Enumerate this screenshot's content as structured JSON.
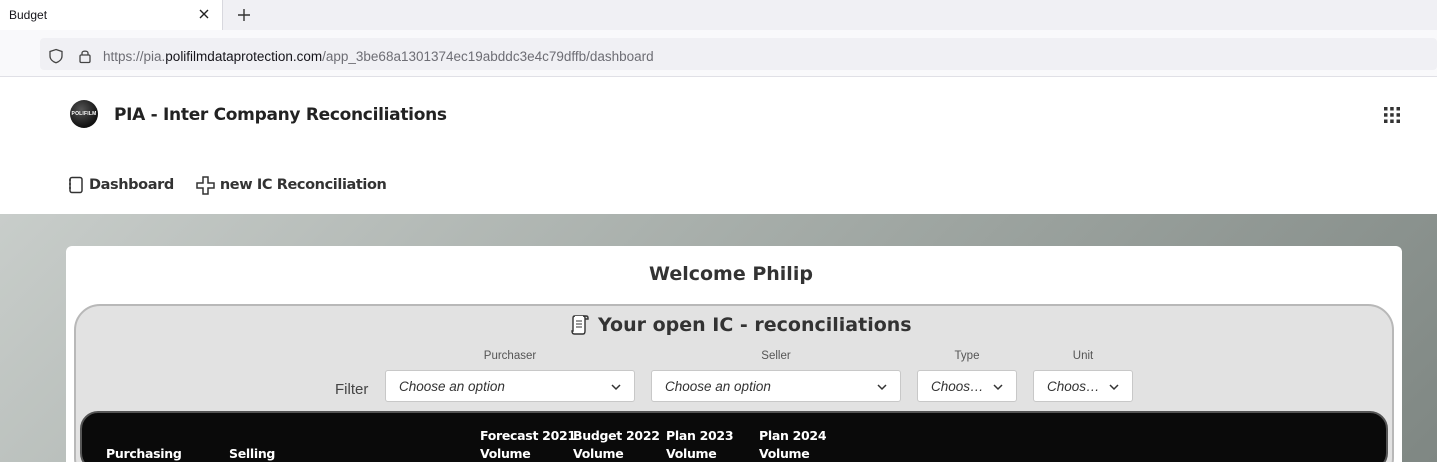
{
  "browser": {
    "tab_title": "Budget",
    "url_prefix": "https://pia.",
    "url_domain": "polifilmdataprotection.com",
    "url_path": "/app_3be68a1301374ec19abddc3e4c79dffb/dashboard"
  },
  "app": {
    "logo_text": "POLIFILM",
    "title": "PIA - Inter Company Reconciliations",
    "nav": [
      {
        "label": "Dashboard",
        "icon": "notebook-icon"
      },
      {
        "label": "new IC Reconciliation",
        "icon": "plus-icon"
      }
    ]
  },
  "main": {
    "welcome": "Welcome Philip",
    "panel_title": "Your open IC - reconciliations",
    "filter_label": "Filter",
    "filters": [
      {
        "label": "Purchaser",
        "value": "Choose an option"
      },
      {
        "label": "Seller",
        "value": "Choose an option"
      },
      {
        "label": "Type",
        "value": "Choos…"
      },
      {
        "label": "Unit",
        "value": "Choos…"
      }
    ],
    "table_headers": [
      {
        "line1": "",
        "line2": "Purchasing"
      },
      {
        "line1": "",
        "line2": "Selling"
      },
      {
        "line1": "Forecast 2021",
        "line2": "Volume"
      },
      {
        "line1": "Budget 2022",
        "line2": "Volume"
      },
      {
        "line1": "Plan 2023",
        "line2": "Volume"
      },
      {
        "line1": "Plan 2024",
        "line2": "Volume"
      }
    ]
  }
}
